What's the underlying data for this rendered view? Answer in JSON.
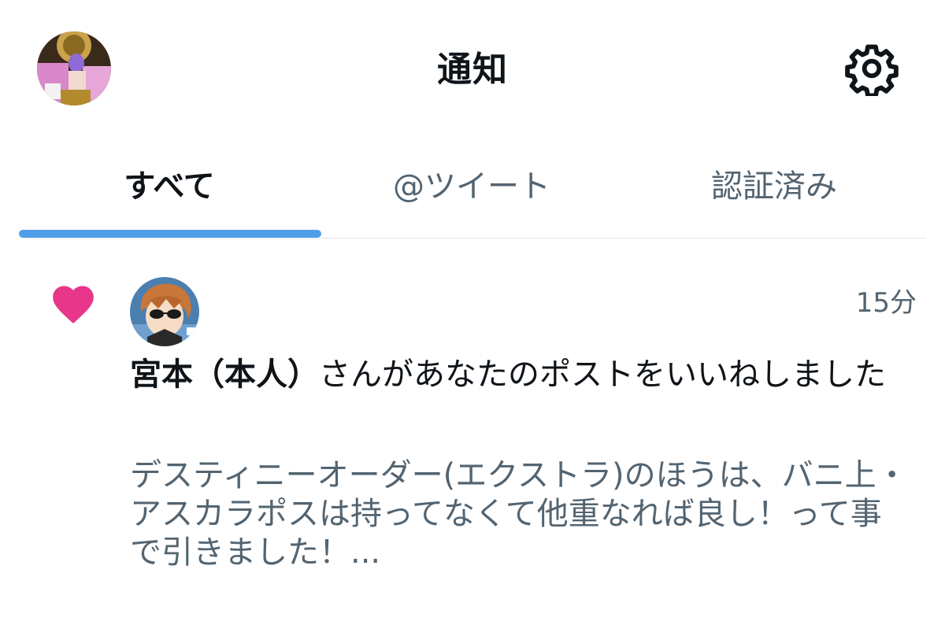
{
  "header": {
    "title": "通知",
    "settings_icon": "gear-icon",
    "avatar_icon": "user-avatar"
  },
  "tabs": [
    {
      "label": "すべて",
      "active": true
    },
    {
      "label": "@ツイート",
      "active": false
    },
    {
      "label": "認証済み",
      "active": false
    }
  ],
  "colors": {
    "accent": "#4f9ee8",
    "like": "#e8378a",
    "primary_text": "#0f1419",
    "secondary_text": "#536471"
  },
  "notifications": [
    {
      "type_icon": "heart-icon",
      "user_name": "宮本（本人）",
      "action_text": "さんがあなたのポストをいいねしました",
      "time": "15分",
      "preview": "デスティニーオーダー(エクストラ)のほうは、バニ上・アスカラポスは持ってなくて他重なれば良し！って事で引きました！..."
    }
  ]
}
